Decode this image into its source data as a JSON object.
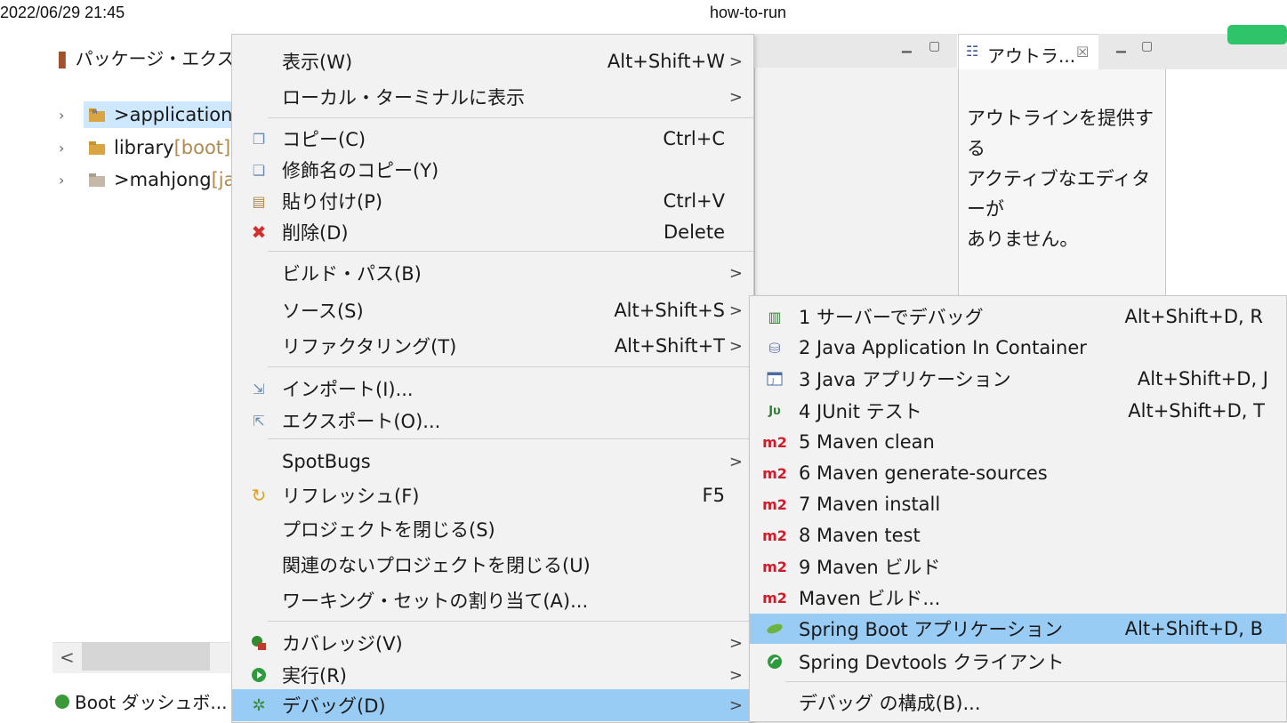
{
  "header": {
    "datetime": "2022/06/29 21:45",
    "title": "how-to-run"
  },
  "package_explorer": {
    "title": "パッケージ・エクス...",
    "projects": [
      {
        "prefix": "> ",
        "name": "application",
        "suffix": "",
        "selected": true
      },
      {
        "prefix": "",
        "name": "library",
        "suffix": " [boot]",
        "selected": false
      },
      {
        "prefix": "> ",
        "name": "mahjong",
        "suffix": " [ja",
        "selected": false
      }
    ],
    "scroll_left": "<",
    "boot_dashboard": "Boot ダッシュボ..."
  },
  "outline": {
    "tab_label": "アウトラ...",
    "close": "☒",
    "message_lines": [
      "アウトラインを提供する",
      "アクティブなエディターが",
      "ありません。"
    ]
  },
  "context_menu": {
    "items": [
      {
        "label": "表示(W)",
        "shortcut": "Alt+Shift+W",
        "submenu": true,
        "icon": ""
      },
      {
        "label": "ローカル・ターミナルに表示",
        "shortcut": "",
        "submenu": true,
        "icon": ""
      },
      {
        "label": "コピー(C)",
        "shortcut": "Ctrl+C",
        "submenu": false,
        "icon": "copy-icon"
      },
      {
        "label": "修飾名のコピー(Y)",
        "shortcut": "",
        "submenu": false,
        "icon": "copy-qualified-icon"
      },
      {
        "label": "貼り付け(P)",
        "shortcut": "Ctrl+V",
        "submenu": false,
        "icon": "paste-icon"
      },
      {
        "label": "削除(D)",
        "shortcut": "Delete",
        "submenu": false,
        "icon": "delete-icon"
      },
      {
        "label": "ビルド・パス(B)",
        "shortcut": "",
        "submenu": true,
        "icon": ""
      },
      {
        "label": "ソース(S)",
        "shortcut": "Alt+Shift+S",
        "submenu": true,
        "icon": ""
      },
      {
        "label": "リファクタリング(T)",
        "shortcut": "Alt+Shift+T",
        "submenu": true,
        "icon": ""
      },
      {
        "label": "インポート(I)...",
        "shortcut": "",
        "submenu": false,
        "icon": "import-icon"
      },
      {
        "label": "エクスポート(O)...",
        "shortcut": "",
        "submenu": false,
        "icon": "export-icon"
      },
      {
        "label": "SpotBugs",
        "shortcut": "",
        "submenu": true,
        "icon": ""
      },
      {
        "label": "リフレッシュ(F)",
        "shortcut": "F5",
        "submenu": false,
        "icon": "refresh-icon"
      },
      {
        "label": "プロジェクトを閉じる(S)",
        "shortcut": "",
        "submenu": false,
        "icon": ""
      },
      {
        "label": "関連のないプロジェクトを閉じる(U)",
        "shortcut": "",
        "submenu": false,
        "icon": ""
      },
      {
        "label": "ワーキング・セットの割り当て(A)...",
        "shortcut": "",
        "submenu": false,
        "icon": ""
      },
      {
        "label": "カバレッジ(V)",
        "shortcut": "",
        "submenu": true,
        "icon": "coverage-icon"
      },
      {
        "label": "実行(R)",
        "shortcut": "",
        "submenu": true,
        "icon": "run-icon"
      },
      {
        "label": "デバッグ(D)",
        "shortcut": "",
        "submenu": true,
        "icon": "debug-icon",
        "highlighted": true
      }
    ]
  },
  "debug_submenu": {
    "items": [
      {
        "label": "1 サーバーでデバッグ",
        "shortcut": "Alt+Shift+D, R",
        "icon": "server-debug-icon"
      },
      {
        "label": "2 Java Application In Container",
        "shortcut": "",
        "icon": "container-icon"
      },
      {
        "label": "3 Java アプリケーション",
        "shortcut": "Alt+Shift+D, J",
        "icon": "java-app-icon"
      },
      {
        "label": "4 JUnit テスト",
        "shortcut": "Alt+Shift+D, T",
        "icon": "junit-icon"
      },
      {
        "label": "5 Maven clean",
        "shortcut": "",
        "icon": "maven-icon"
      },
      {
        "label": "6 Maven generate-sources",
        "shortcut": "",
        "icon": "maven-icon"
      },
      {
        "label": "7 Maven install",
        "shortcut": "",
        "icon": "maven-icon"
      },
      {
        "label": "8 Maven test",
        "shortcut": "",
        "icon": "maven-icon"
      },
      {
        "label": "9 Maven ビルド",
        "shortcut": "",
        "icon": "maven-icon"
      },
      {
        "label": "Maven ビルド...",
        "shortcut": "",
        "icon": "maven-icon"
      },
      {
        "label": "Spring Boot アプリケーション",
        "shortcut": "Alt+Shift+D, B",
        "icon": "spring-boot-icon",
        "highlighted": true
      },
      {
        "label": "Spring Devtools クライアント",
        "shortcut": "",
        "icon": "spring-devtools-icon"
      },
      {
        "label": "デバッグ の構成(B)...",
        "shortcut": "",
        "icon": ""
      }
    ],
    "maven_badge": "m2",
    "junit_badge": "Jυ"
  },
  "submenu_arrow": ">",
  "colors": {
    "menu_bg": "#f2f2f2",
    "highlight": "#99ccf5",
    "selection": "#cde8ff",
    "maven_red": "#d11a2a",
    "spring_green": "#6db33f"
  }
}
